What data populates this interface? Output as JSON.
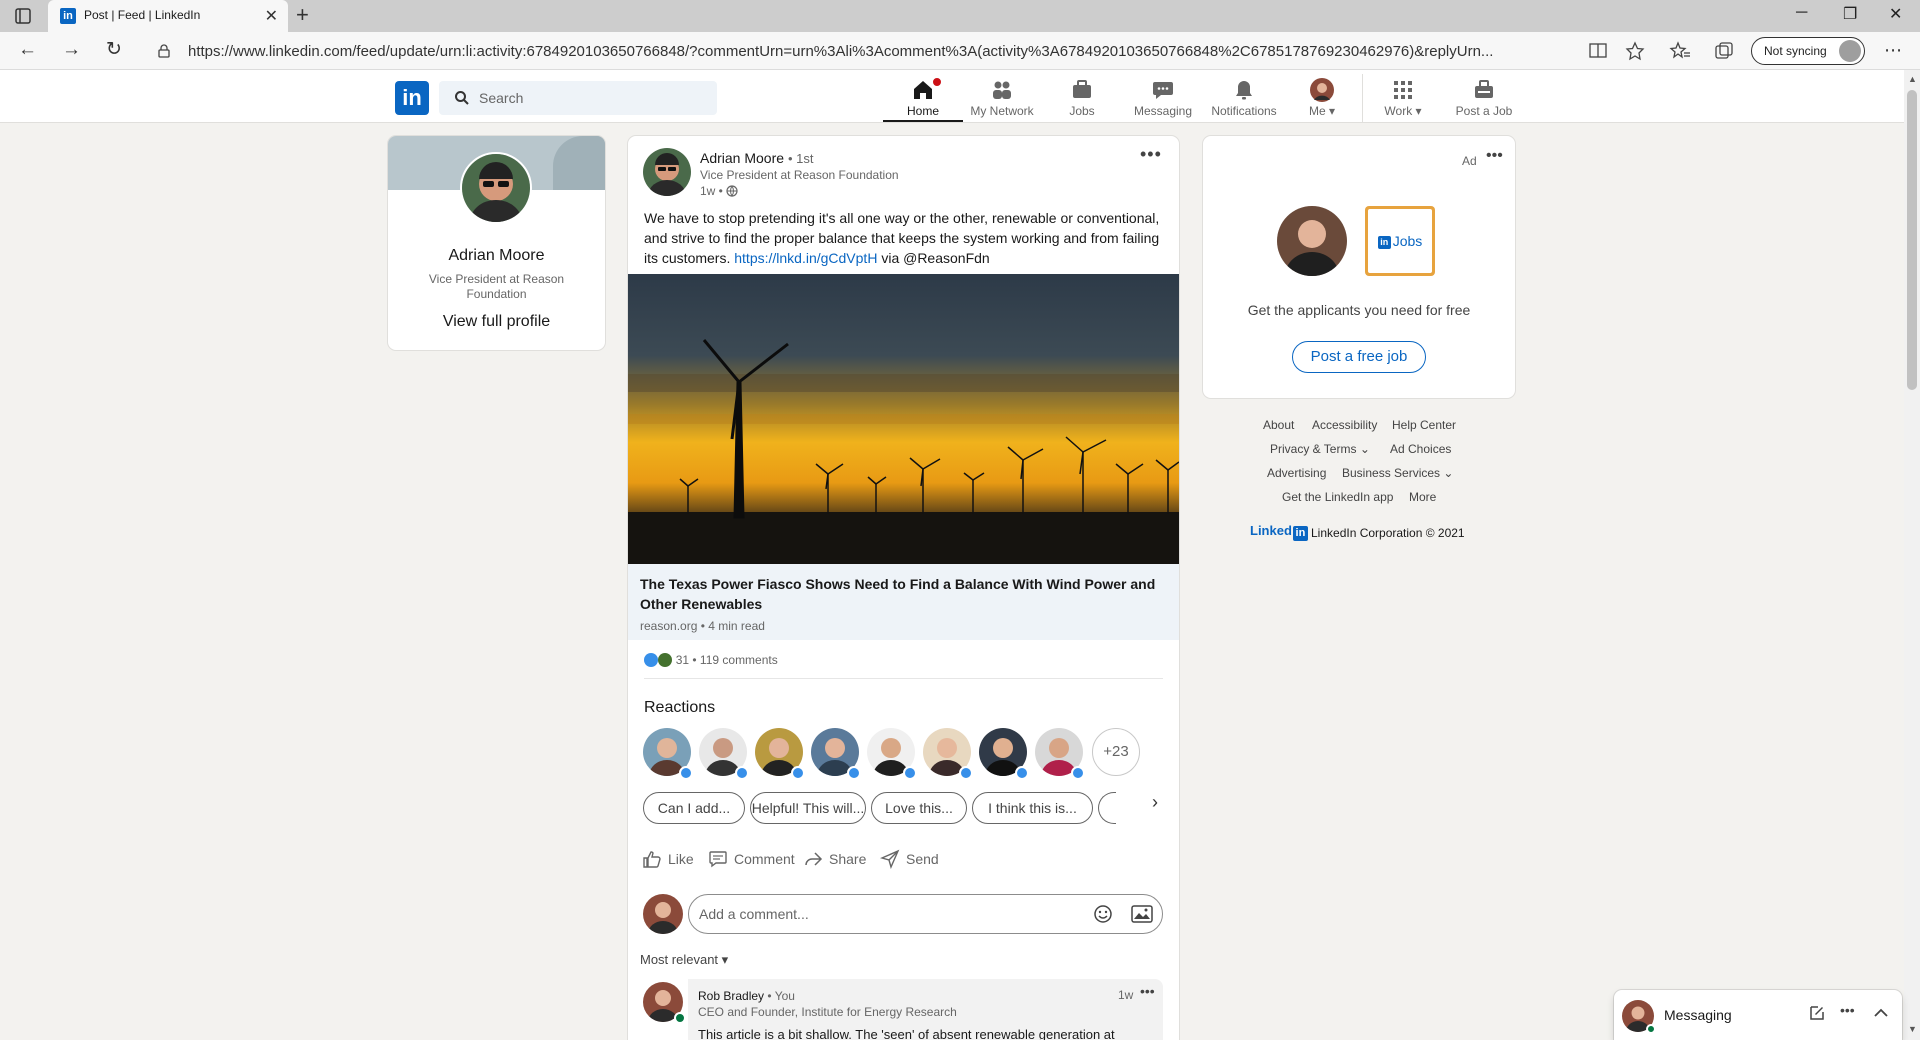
{
  "browser": {
    "tab_title": "Post | Feed | LinkedIn",
    "url": "https://www.linkedin.com/feed/update/urn:li:activity:6784920103650766848/?commentUrn=urn%3Ali%3Acomment%3A(activity%3A6784920103650766848%2C6785178769230462976)&replyUrn...",
    "sync_label": "Not syncing"
  },
  "header": {
    "search_placeholder": "Search",
    "nav": {
      "home": "Home",
      "network": "My Network",
      "jobs": "Jobs",
      "messaging": "Messaging",
      "notifications": "Notifications",
      "me": "Me",
      "work": "Work",
      "post_job": "Post a Job"
    }
  },
  "profile": {
    "name": "Adrian Moore",
    "title": "Vice President at Reason Foundation",
    "view_profile": "View full profile"
  },
  "post": {
    "author": "Adrian Moore",
    "degree": "• 1st",
    "subtitle": "Vice President at Reason Foundation",
    "time": "1w •",
    "text_before": "We have to stop pretending it's all one way or the other, renewable or conventional, and strive to find the proper balance that keeps the system working and from failing its customers. ",
    "link": "https://lnkd.in/gCdVptH",
    "text_after": " via @ReasonFdn",
    "article_title": "The Texas Power Fiasco Shows Need to Find a Balance With Wind Power and Other Renewables",
    "article_meta": "reason.org • 4 min read",
    "reaction_count": "31",
    "comments_count": "• 119 comments",
    "reactions_title": "Reactions",
    "more_reactors": "+23",
    "chips": [
      "Can I add...",
      "Helpful! This will...",
      "Love this...",
      "I think this is..."
    ],
    "actions": {
      "like": "Like",
      "comment": "Comment",
      "share": "Share",
      "send": "Send"
    },
    "comment_placeholder": "Add a comment...",
    "sort_label": "Most relevant"
  },
  "comment": {
    "name": "Rob Bradley",
    "you": "• You",
    "headline": "CEO and Founder, Institute for Energy Research",
    "time": "1w",
    "text": "This article is a bit shallow. The 'seen' of absent renewable generation at"
  },
  "ad": {
    "label": "Ad",
    "jobs_logo": "Jobs",
    "mini_logo": "in",
    "text": "Get the applicants you need for free",
    "button": "Post a free job"
  },
  "footer": {
    "about": "About",
    "accessibility": "Accessibility",
    "help": "Help Center",
    "privacy": "Privacy & Terms",
    "ad_choices": "Ad Choices",
    "advertising": "Advertising",
    "business": "Business Services",
    "app": "Get the LinkedIn app",
    "more": "More",
    "logo_text": "Linked",
    "logo_in": "in",
    "copyright": "LinkedIn Corporation © 2021"
  },
  "messaging": {
    "title": "Messaging"
  },
  "colors": {
    "linkedin_blue": "#0a66c2",
    "notification_red": "#cc1016",
    "online_green": "#057642"
  }
}
